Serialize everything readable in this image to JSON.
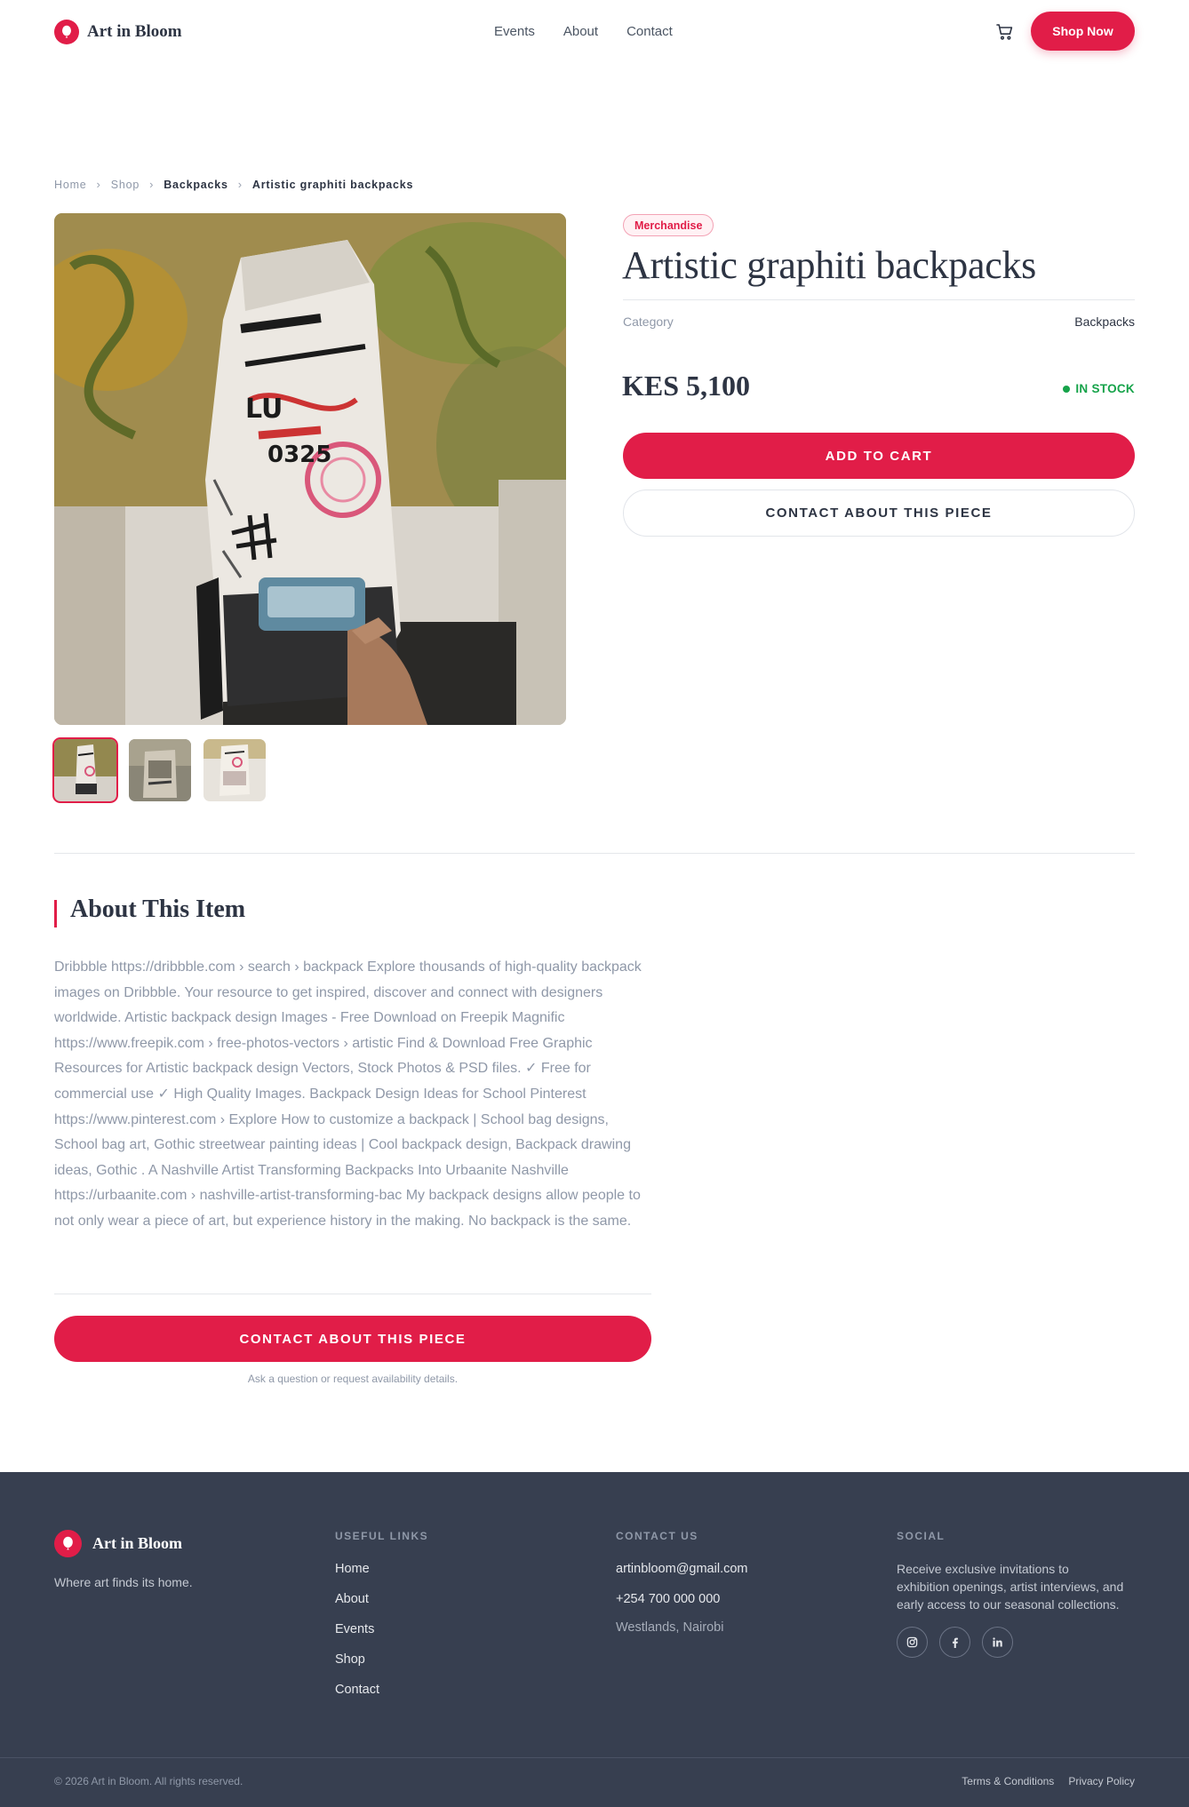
{
  "brand": {
    "name": "Art in Bloom",
    "accent": "#e11d48"
  },
  "nav": {
    "items": [
      "Events",
      "About",
      "Contact"
    ],
    "cta": "Shop Now"
  },
  "breadcrumb": [
    "Home",
    "Shop",
    "Backpacks",
    "Artistic graphiti backpacks"
  ],
  "product": {
    "badge": "Merchandise",
    "title": "Artistic graphiti backpacks",
    "category_label": "Category",
    "category_value": "Backpacks",
    "price": "KES 5,100",
    "stock": "IN STOCK",
    "add_to_cart": "ADD TO CART",
    "contact": "CONTACT ABOUT THIS PIECE",
    "thumbnail_count": 3
  },
  "about": {
    "title": "About This Item",
    "text": "Dribbble https://dribbble.com › search › backpack Explore thousands of high-quality backpack images on Dribbble. Your resource to get inspired, discover and connect with designers worldwide. Artistic backpack design Images - Free Download on Freepik Magnific https://www.freepik.com › free-photos-vectors › artistic Find & Download Free Graphic Resources for Artistic backpack design Vectors, Stock Photos & PSD files. ✓ Free for commercial use ✓ High Quality Images. Backpack Design Ideas for School Pinterest https://www.pinterest.com › Explore How to customize a backpack | School bag designs, School bag art, Gothic streetwear painting ideas | Cool backpack design, Backpack drawing ideas, Gothic . A Nashville Artist Transforming Backpacks Into Urbaanite Nashville https://urbaanite.com › nashville-artist-transforming-bac My backpack designs allow people to not only wear a piece of art, but experience history in the making. No backpack is the same.",
    "contact": "CONTACT ABOUT THIS PIECE",
    "helper": "Ask a question or request availability details."
  },
  "footer": {
    "tagline": "Where art finds its home.",
    "useful_links_head": "USEFUL LINKS",
    "useful_links": [
      "Home",
      "About",
      "Events",
      "Shop",
      "Contact"
    ],
    "contact_head": "CONTACT US",
    "email": "artinbloom@gmail.com",
    "phone": "+254 700 000 000",
    "location": "Westlands, Nairobi",
    "social_head": "SOCIAL",
    "social_text": "Receive exclusive invitations to exhibition openings, artist interviews, and early access to our seasonal collections.",
    "social_icons": [
      "instagram-icon",
      "facebook-icon",
      "linkedin-icon"
    ],
    "copyright": "© 2026 Art in Bloom. All rights reserved.",
    "terms": "Terms & Conditions",
    "privacy": "Privacy Policy"
  }
}
